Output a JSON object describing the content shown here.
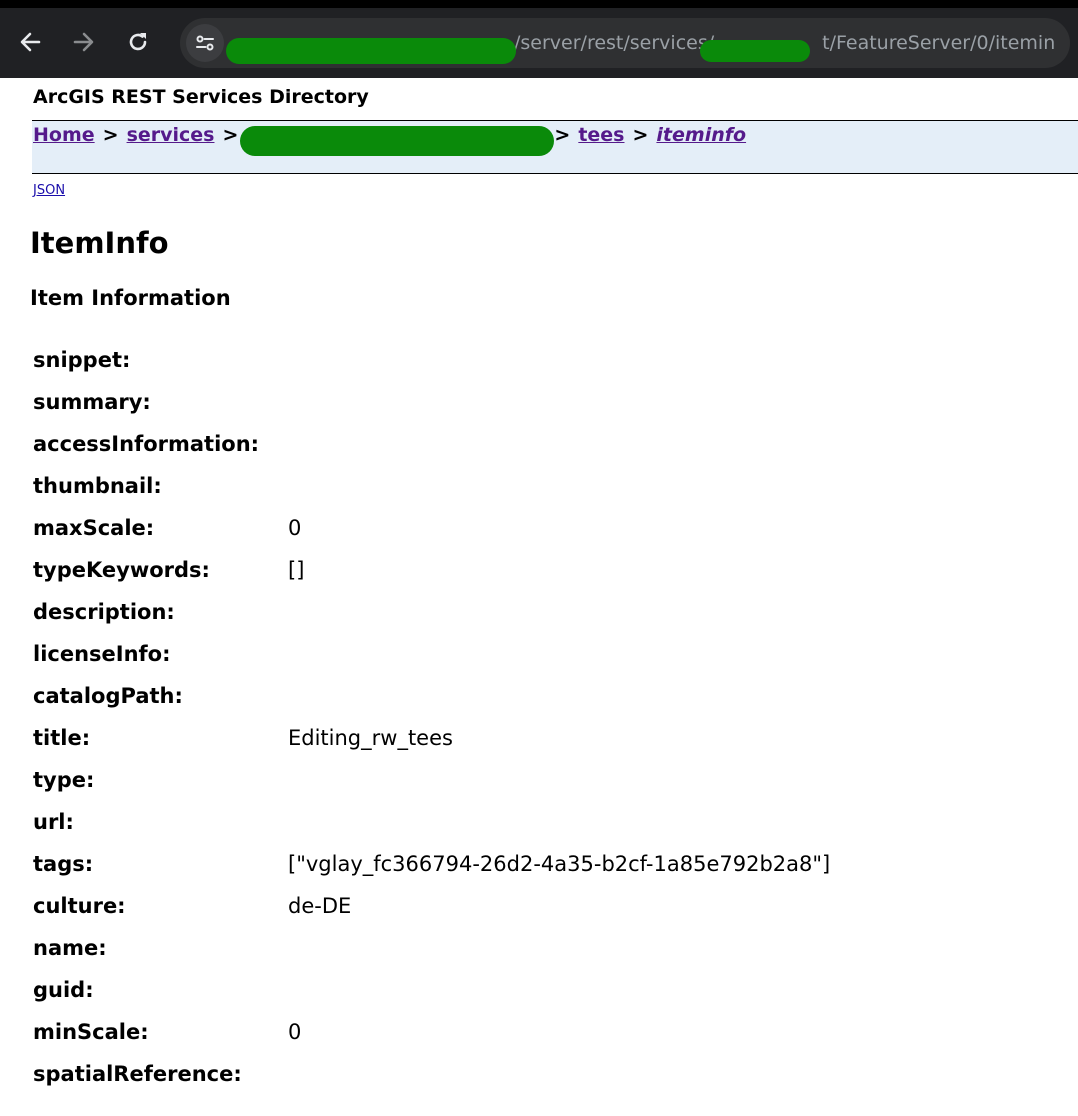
{
  "browser": {
    "url_visible_parts": [
      "/server/rest/services/",
      "t/FeatureServer/0/iteminfo"
    ],
    "icons": [
      "back-arrow-icon",
      "forward-arrow-icon",
      "reload-icon",
      "site-settings-icon"
    ]
  },
  "page": {
    "heading": "ArcGIS REST Services Directory",
    "breadcrumb": {
      "home": "Home",
      "services": "services",
      "layer": "tees",
      "current": "iteminfo",
      "separator": ">"
    },
    "json_link": "JSON",
    "title": "ItemInfo",
    "subtitle": "Item Information"
  },
  "item_info": [
    {
      "key": "snippet:",
      "value": ""
    },
    {
      "key": "summary:",
      "value": ""
    },
    {
      "key": "accessInformation:",
      "value": ""
    },
    {
      "key": "thumbnail:",
      "value": ""
    },
    {
      "key": "maxScale:",
      "value": "0"
    },
    {
      "key": "typeKeywords:",
      "value": "[]"
    },
    {
      "key": "description:",
      "value": ""
    },
    {
      "key": "licenseInfo:",
      "value": ""
    },
    {
      "key": "catalogPath:",
      "value": ""
    },
    {
      "key": "title:",
      "value": "Editing_rw_tees"
    },
    {
      "key": "type:",
      "value": ""
    },
    {
      "key": "url:",
      "value": ""
    },
    {
      "key": "tags:",
      "value": "[\"vglay_fc366794-26d2-4a35-b2cf-1a85e792b2a8\"]"
    },
    {
      "key": "culture:",
      "value": "de-DE"
    },
    {
      "key": "name:",
      "value": ""
    },
    {
      "key": "guid:",
      "value": ""
    },
    {
      "key": "minScale:",
      "value": "0"
    },
    {
      "key": "spatialReference:",
      "value": ""
    }
  ],
  "colors": {
    "browser_bg": "#202124",
    "breadcrumb_bg": "#e4eef8",
    "visited_link": "#551a8b",
    "link": "#1a0dab",
    "redaction": "#0a8a0a"
  }
}
